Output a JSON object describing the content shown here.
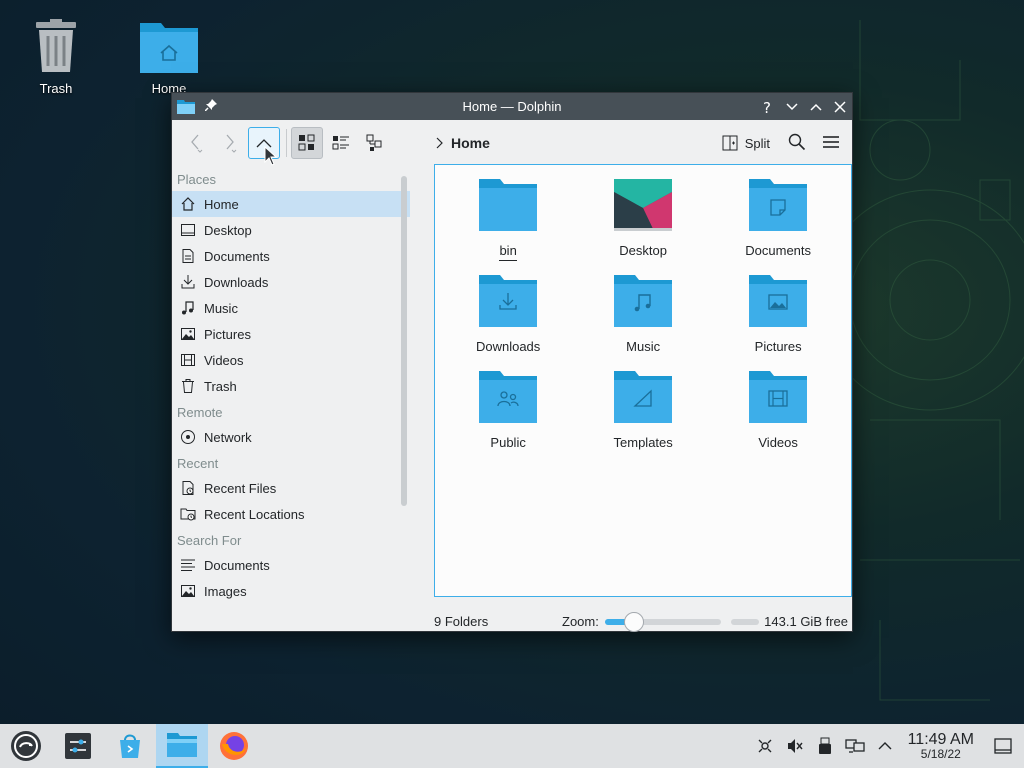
{
  "desktop": {
    "icons": [
      {
        "label": "Trash",
        "icon": "trash-icon"
      },
      {
        "label": "Home",
        "icon": "home-folder-icon"
      }
    ]
  },
  "window": {
    "title": "Home — Dolphin",
    "toolbar": {
      "split_label": "Split",
      "breadcrumb": [
        "Home"
      ]
    },
    "sidebar": {
      "sections": [
        {
          "title": "Places",
          "items": [
            {
              "label": "Home",
              "icon": "home-icon",
              "selected": true
            },
            {
              "label": "Desktop",
              "icon": "desktop-icon"
            },
            {
              "label": "Documents",
              "icon": "documents-icon"
            },
            {
              "label": "Downloads",
              "icon": "downloads-icon"
            },
            {
              "label": "Music",
              "icon": "music-icon"
            },
            {
              "label": "Pictures",
              "icon": "pictures-icon"
            },
            {
              "label": "Videos",
              "icon": "videos-icon"
            },
            {
              "label": "Trash",
              "icon": "trash-icon"
            }
          ]
        },
        {
          "title": "Remote",
          "items": [
            {
              "label": "Network",
              "icon": "network-icon"
            }
          ]
        },
        {
          "title": "Recent",
          "items": [
            {
              "label": "Recent Files",
              "icon": "recent-files-icon"
            },
            {
              "label": "Recent Locations",
              "icon": "recent-locations-icon"
            }
          ]
        },
        {
          "title": "Search For",
          "items": [
            {
              "label": "Documents",
              "icon": "search-documents-icon"
            },
            {
              "label": "Images",
              "icon": "search-images-icon"
            }
          ]
        }
      ]
    },
    "folders": [
      {
        "name": "bin",
        "emblem": "none"
      },
      {
        "name": "Desktop",
        "emblem": "desktop-wallpaper"
      },
      {
        "name": "Documents",
        "emblem": "document"
      },
      {
        "name": "Downloads",
        "emblem": "download"
      },
      {
        "name": "Music",
        "emblem": "music"
      },
      {
        "name": "Pictures",
        "emblem": "picture"
      },
      {
        "name": "Public",
        "emblem": "people"
      },
      {
        "name": "Templates",
        "emblem": "template"
      },
      {
        "name": "Videos",
        "emblem": "video"
      }
    ],
    "status": {
      "count": "9 Folders",
      "zoom_label": "Zoom:",
      "zoom_level": 0.2,
      "free_space": "143.1 GiB free"
    }
  },
  "taskbar": {
    "clock_time": "11:49 AM",
    "clock_date": "5/18/22"
  },
  "colors": {
    "accent": "#3daee9",
    "folder": "#3daee9",
    "folder_dark": "#1d99d3",
    "titlebar": "#475057"
  }
}
